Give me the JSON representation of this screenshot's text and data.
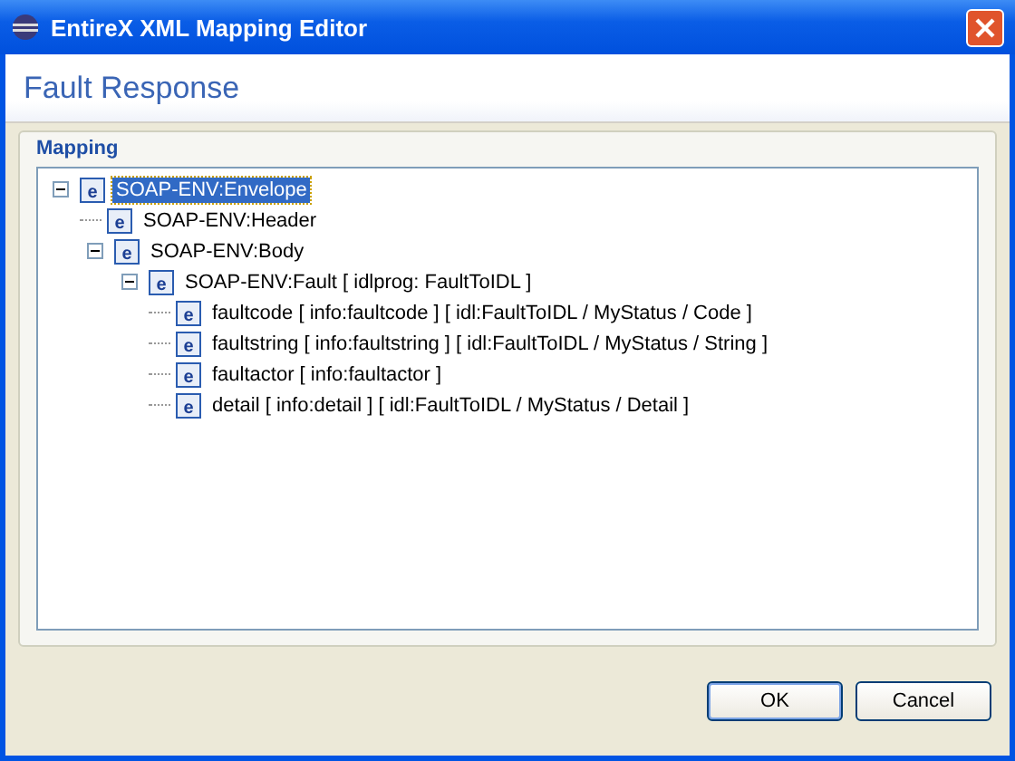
{
  "window": {
    "title": "EntireX XML Mapping Editor"
  },
  "header": {
    "title": "Fault Response"
  },
  "group": {
    "label": "Mapping"
  },
  "tree": [
    {
      "icon": "e",
      "label": "SOAP-ENV:Envelope",
      "selected": true,
      "expanded": true,
      "children": [
        {
          "icon": "e",
          "label": "SOAP-ENV:Header",
          "selected": false
        },
        {
          "icon": "e",
          "label": "SOAP-ENV:Body",
          "selected": false,
          "expanded": true,
          "children": [
            {
              "icon": "e",
              "label": "SOAP-ENV:Fault  [ idlprog: FaultToIDL ]",
              "selected": false,
              "expanded": true,
              "children": [
                {
                  "icon": "e",
                  "label": "faultcode [ info:faultcode ]  [ idl:FaultToIDL / MyStatus / Code ]",
                  "selected": false
                },
                {
                  "icon": "e",
                  "label": "faultstring [ info:faultstring ]  [ idl:FaultToIDL / MyStatus / String ]",
                  "selected": false
                },
                {
                  "icon": "e",
                  "label": "faultactor [ info:faultactor ]",
                  "selected": false
                },
                {
                  "icon": "e",
                  "label": "detail [ info:detail ]  [ idl:FaultToIDL / MyStatus / Detail ]",
                  "selected": false
                }
              ]
            }
          ]
        }
      ]
    }
  ],
  "buttons": [
    {
      "label": "OK",
      "default": true
    },
    {
      "label": "Cancel",
      "default": false
    }
  ]
}
